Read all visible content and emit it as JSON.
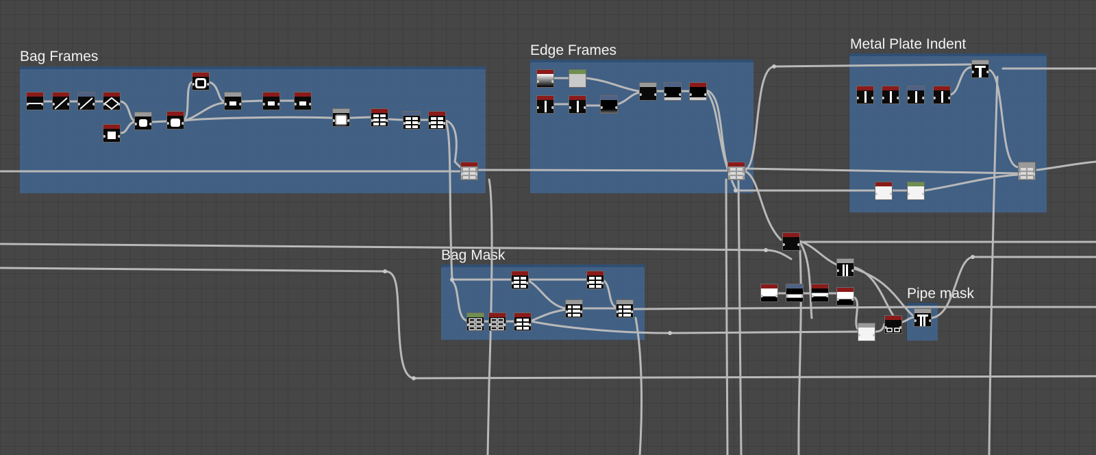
{
  "colors": {
    "background": "#464646",
    "grid": "#3e3e3e",
    "frame": "#406896",
    "wire": "#b9b9b9",
    "header_red": "#8b1a1a",
    "header_gray": "#9a9a9a",
    "header_blue": "#4f6286",
    "header_green": "#6f8f4f"
  },
  "frames": [
    {
      "id": "bag-frames",
      "title": "Bag Frames"
    },
    {
      "id": "edge-frames",
      "title": "Edge Frames"
    },
    {
      "id": "metal-plate-indent",
      "title": "Metal Plate Indent"
    },
    {
      "id": "bag-mask",
      "title": "Bag Mask"
    },
    {
      "id": "pipe-mask",
      "title": "Pipe mask"
    }
  ]
}
